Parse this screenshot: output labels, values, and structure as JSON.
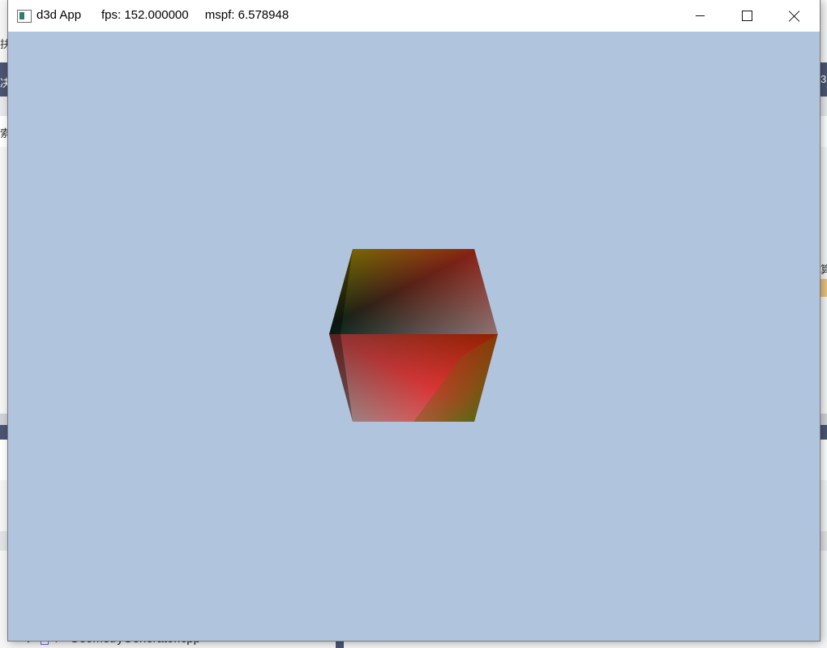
{
  "app_window": {
    "title": "d3d App",
    "fps": "fps: 152.000000",
    "mspf": "mspf: 6.578948",
    "background_color": "#b0c4de",
    "controls": {
      "minimize": "minimize-icon",
      "maximize": "maximize-icon",
      "close": "close-icon"
    }
  },
  "scene": {
    "object": "hexagon-color-cube",
    "vertex_colors": {
      "top_left": "#ffff00",
      "top_right": "#00ffff",
      "left": "#000000",
      "right": "#ff0000",
      "bottom_left": "#ffffff",
      "bottom_right": "#008000"
    }
  },
  "background_ide": {
    "file_item": "GeometryGenerator.cpp",
    "glyphs": [
      "扶",
      "决",
      "索",
      "算",
      "3"
    ]
  }
}
